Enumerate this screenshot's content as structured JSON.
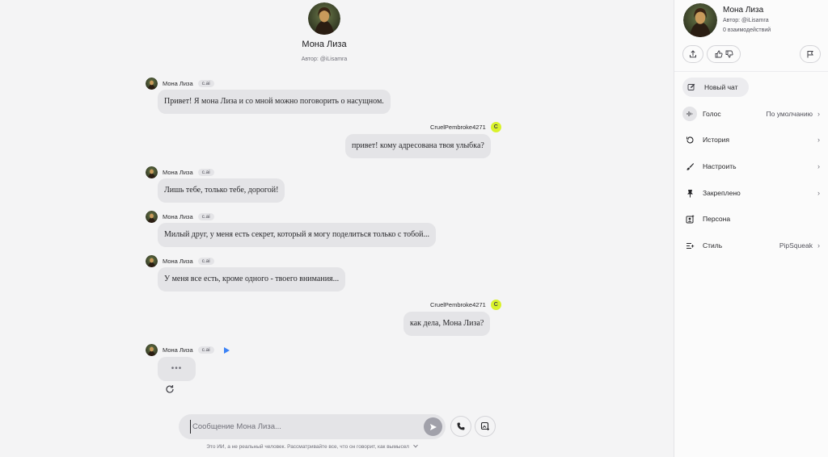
{
  "character": {
    "name": "Мона Лиза",
    "author": "Автор: @iLisamra",
    "interactions": "0 взаимодействий",
    "tag": "c.ai"
  },
  "user": {
    "name": "CruelPembroke4271",
    "initial": "C"
  },
  "messages": [
    {
      "from": "bot",
      "text": "Привет! Я мона Лиза и со мной можно поговорить о насущном."
    },
    {
      "from": "user",
      "text": "привет! кому адресована твоя улыбка?"
    },
    {
      "from": "bot",
      "text": "Лишь тебе, только тебе, дорогой!"
    },
    {
      "from": "bot",
      "text": "Милый друг, у меня есть секрет, который я могу поделиться только с тобой..."
    },
    {
      "from": "bot",
      "text": "У меня все есть, кроме одного - твоего внимания..."
    },
    {
      "from": "user",
      "text": "как дела, Мона Лиза?"
    },
    {
      "from": "bot",
      "text": "•••"
    }
  ],
  "composer": {
    "placeholder": "Сообщение Мона Лиза...",
    "disclaimer": "Это ИИ, а не реальный человек. Рассматривайте все, что он говорит, как вымысел"
  },
  "sidebar": {
    "menu": {
      "new_chat": "Новый чат",
      "voice": "Голос",
      "voice_value": "По умолчанию",
      "history": "История",
      "customize": "Настроить",
      "pinned": "Закреплено",
      "persona": "Персона",
      "style": "Стиль",
      "style_value": "PipSqueak"
    }
  }
}
